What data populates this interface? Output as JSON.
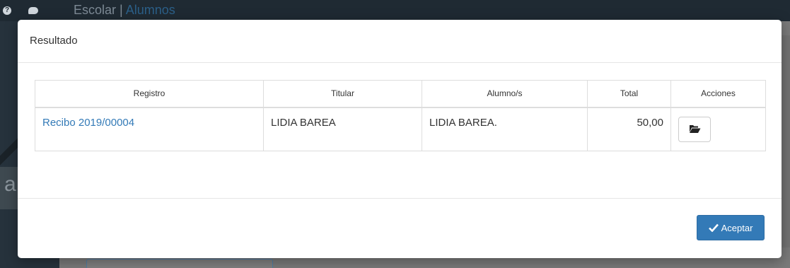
{
  "background": {
    "brand": "Escolar",
    "separator": "|",
    "module": "Alumnos"
  },
  "modal": {
    "title": "Resultado",
    "table": {
      "columns": [
        "Registro",
        "Titular",
        "Alumno/s",
        "Total",
        "Acciones"
      ],
      "rows": [
        {
          "registro": "Recibo 2019/00004",
          "titular": "LIDIA BAREA",
          "alumnos": "LIDIA BAREA.",
          "total": "50,00",
          "action_icon": "folder-open-icon"
        }
      ]
    },
    "accept_label": "Aceptar"
  },
  "colors": {
    "primary": "#337ab7",
    "link": "#337ab7",
    "topbar": "#1f2a33"
  }
}
